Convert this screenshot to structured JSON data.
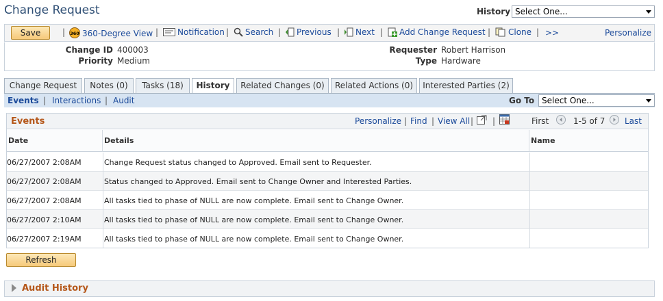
{
  "page": {
    "title": "Change Request"
  },
  "history_select": {
    "label": "History",
    "value": "Select One..."
  },
  "toolbar": {
    "save_label": "Save",
    "items": [
      {
        "label": "360-Degree View",
        "icon": "360-icon"
      },
      {
        "label": "Notification",
        "icon": "notification-icon"
      },
      {
        "label": "Search",
        "icon": "search-icon"
      },
      {
        "label": "Previous",
        "icon": "previous-icon"
      },
      {
        "label": "Next",
        "icon": "next-icon"
      },
      {
        "label": "Add Change Request",
        "icon": "add-icon"
      },
      {
        "label": "Clone",
        "icon": "clone-icon"
      }
    ],
    "more_label": ">>",
    "personalize_label": "Personalize"
  },
  "info": {
    "change_id_label": "Change ID",
    "change_id": "400003",
    "priority_label": "Priority",
    "priority": "Medium",
    "requester_label": "Requester",
    "requester": "Robert Harrison",
    "type_label": "Type",
    "type": "Hardware"
  },
  "tabs": [
    {
      "label": "Change Request",
      "active": false
    },
    {
      "label": "Notes (0)",
      "active": false
    },
    {
      "label": "Tasks (18)",
      "active": false
    },
    {
      "label": "History",
      "active": true
    },
    {
      "label": "Related Changes (0)",
      "active": false
    },
    {
      "label": "Related Actions (0)",
      "active": false
    },
    {
      "label": "Interested Parties (2)",
      "active": false
    }
  ],
  "subnav": {
    "items": [
      "Events",
      "Interactions",
      "Audit"
    ],
    "goto_label": "Go To",
    "goto_value": "Select One..."
  },
  "events": {
    "title": "Events",
    "nav": {
      "personalize": "Personalize",
      "find": "Find",
      "view_all": "View All",
      "first": "First",
      "range": "1-5 of 7",
      "last": "Last"
    },
    "columns": [
      "Date",
      "Details",
      "Name"
    ],
    "rows": [
      {
        "date": "06/27/2007  2:08AM",
        "details": "Change Request status changed to Approved.  Email sent to Requester.",
        "name": ""
      },
      {
        "date": "06/27/2007  2:08AM",
        "details": "Status changed to Approved.  Email sent to Change Owner and Interested Parties.",
        "name": ""
      },
      {
        "date": "06/27/2007  2:08AM",
        "details": "All tasks tied to phase of NULL are now complete.  Email sent to Change Owner.",
        "name": ""
      },
      {
        "date": "06/27/2007  2:10AM",
        "details": "All tasks tied to phase of NULL are now complete.  Email sent to Change Owner.",
        "name": ""
      },
      {
        "date": "06/27/2007  2:19AM",
        "details": "All tasks tied to phase of NULL are now complete.  Email sent to Change Owner.",
        "name": ""
      }
    ]
  },
  "refresh_label": "Refresh",
  "audit_history": {
    "title": "Audit History"
  },
  "colors": {
    "title": "#2f4f75",
    "link": "#1b4a9a",
    "section_title": "#b5571a",
    "subnav_bg": "#d7e4f2"
  }
}
